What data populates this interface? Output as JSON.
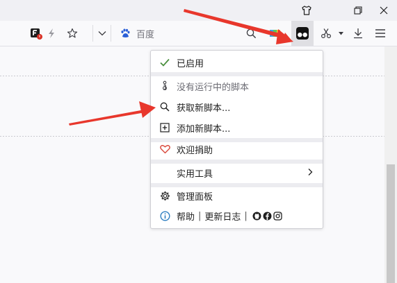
{
  "search": {
    "placeholder": "百度"
  },
  "menu": {
    "enabled": "已启用",
    "no_scripts": "没有运行中的脚本",
    "get_scripts": "获取新脚本...",
    "add_script": "添加新脚本...",
    "donate": "欢迎捐助",
    "utilities": "实用工具",
    "dashboard": "管理面板",
    "help": "帮助",
    "changelog": "更新日志",
    "separator": "|"
  },
  "icons": {
    "shirt": "shirt-icon",
    "restore": "restore-window-icon",
    "close": "close-icon",
    "extension_f": "extension-f-icon",
    "bolt": "bolt-icon",
    "star": "bookmark-star-icon",
    "chevron": "chevron-down-icon",
    "baidu": "baidu-paw-icon",
    "magnifier": "search-icon",
    "colorful": "colorful-extension-icon",
    "tampermonkey": "tampermonkey-icon",
    "scissors": "scissors-icon",
    "download": "download-icon",
    "hamburger": "hamburger-menu-icon"
  },
  "colors": {
    "check": "#4a8f3e",
    "heart": "#d9483b",
    "info": "#2f7fc1",
    "arrow": "#e8372c"
  }
}
